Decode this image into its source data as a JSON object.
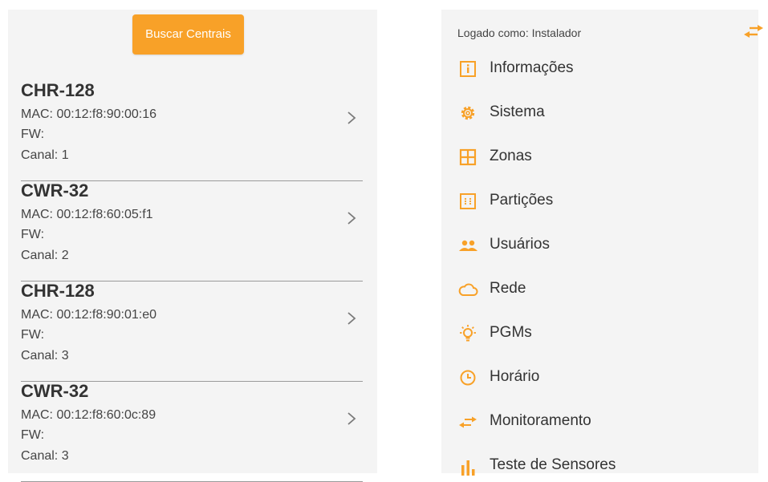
{
  "colors": {
    "accent": "#f8a128",
    "panel": "#f4f4f4",
    "text": "#333333",
    "divider": "#9a9a9a"
  },
  "left": {
    "search_button": "Buscar Centrais",
    "devices": [
      {
        "name": "CHR-128",
        "mac": "MAC: 00:12:f8:90:00:16",
        "fw": "FW:",
        "canal": "Canal: 1"
      },
      {
        "name": "CWR-32",
        "mac": "MAC: 00:12:f8:60:05:f1",
        "fw": "FW:",
        "canal": "Canal: 2"
      },
      {
        "name": "CHR-128",
        "mac": "MAC: 00:12:f8:90:01:e0",
        "fw": "FW:",
        "canal": "Canal: 3"
      },
      {
        "name": "CWR-32",
        "mac": "MAC: 00:12:f8:60:0c:89",
        "fw": "FW:",
        "canal": "Canal: 3"
      }
    ]
  },
  "right": {
    "logged_as": "Logado como: Instalador",
    "swap_icon": "swap-arrows-icon",
    "menu": [
      {
        "label": "Informações",
        "icon": "info-icon"
      },
      {
        "label": "Sistema",
        "icon": "gear-icon"
      },
      {
        "label": "Zonas",
        "icon": "grid-icon"
      },
      {
        "label": "Partições",
        "icon": "partition-icon"
      },
      {
        "label": "Usuários",
        "icon": "users-icon"
      },
      {
        "label": "Rede",
        "icon": "cloud-icon"
      },
      {
        "label": "PGMs",
        "icon": "lightbulb-icon"
      },
      {
        "label": "Horário",
        "icon": "clock-icon"
      },
      {
        "label": "Monitoramento",
        "icon": "swap-arrows-icon"
      },
      {
        "label": "Teste de Sensores",
        "icon": "bar-chart-icon"
      }
    ]
  }
}
